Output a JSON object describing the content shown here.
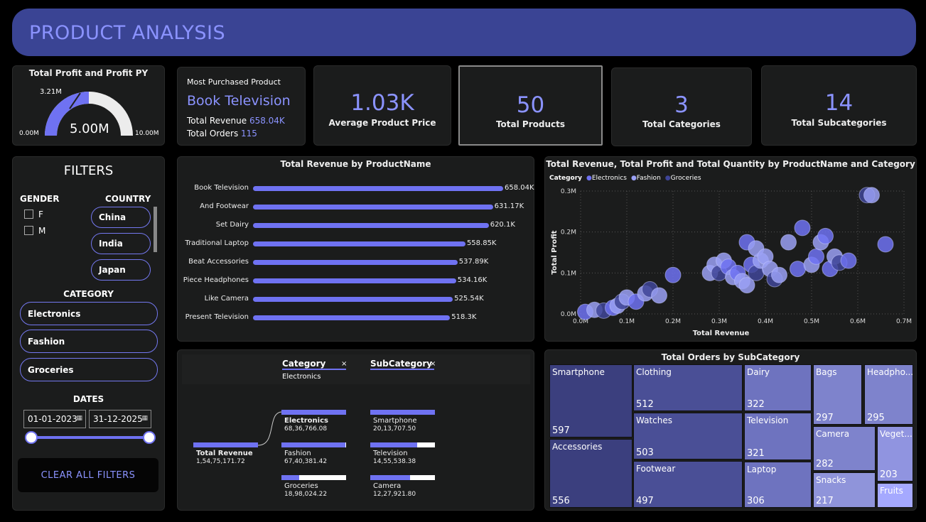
{
  "header": {
    "title": "PRODUCT ANALYSIS"
  },
  "gauge": {
    "title": "Total Profit and Profit PY",
    "value": "5.00M",
    "min": "0.00M",
    "max": "10.00M",
    "target": "3.21M",
    "fill_fraction": 0.5
  },
  "most_purchased": {
    "label": "Most Purchased Product",
    "product": "Book Television",
    "revenue_label": "Total Revenue",
    "revenue": "658.04K",
    "orders_label": "Total Orders",
    "orders": "115"
  },
  "kpis": [
    {
      "value": "1.03K",
      "label": "Average Product Price"
    },
    {
      "value": "50",
      "label": "Total Products"
    },
    {
      "value": "3",
      "label": "Total Categories"
    },
    {
      "value": "14",
      "label": "Total Subcategories"
    }
  ],
  "filters": {
    "title": "FILTERS",
    "gender_label": "GENDER",
    "genders": [
      "F",
      "M"
    ],
    "country_label": "COUNTRY",
    "countries": [
      "China",
      "India",
      "Japan"
    ],
    "category_label": "CATEGORY",
    "categories": [
      "Electronics",
      "Fashion",
      "Groceries"
    ],
    "dates_label": "DATES",
    "date_from": "01-01-2023",
    "date_to": "31-12-2025",
    "clear_label": "CLEAR ALL FILTERS",
    "calendar_icon": "▦"
  },
  "revenue_by_product": {
    "chart_data": {
      "type": "bar",
      "title": "Total Revenue by ProductName",
      "categories": [
        "Book Television",
        "And Footwear",
        "Set Dairy",
        "Traditional Laptop",
        "Beat Accessories",
        "Piece Headphones",
        "Like Camera",
        "Present Television"
      ],
      "values": [
        658.04,
        631.17,
        620.1,
        558.85,
        537.89,
        534.16,
        525.54,
        518.3
      ],
      "value_labels": [
        "658.04K",
        "631.17K",
        "620.1K",
        "558.85K",
        "537.89K",
        "534.16K",
        "525.54K",
        "518.3K"
      ],
      "unit": "K",
      "xlim": [
        0,
        658.04
      ]
    }
  },
  "scatter": {
    "chart_data": {
      "type": "scatter",
      "title": "Total Revenue, Total Profit and Total Quantity by ProductName and Category",
      "legend_title": "Category",
      "legend": [
        {
          "name": "Electronics",
          "color": "#6f72f2"
        },
        {
          "name": "Fashion",
          "color": "#9aa0f5"
        },
        {
          "name": "Groceries",
          "color": "#3f4598"
        }
      ],
      "xlabel": "Total Revenue",
      "ylabel": "Total Profit",
      "x_ticks": [
        "0.0M",
        "0.1M",
        "0.2M",
        "0.3M",
        "0.4M",
        "0.5M",
        "0.6M",
        "0.7M"
      ],
      "y_ticks": [
        "0.0M",
        "0.1M",
        "0.2M",
        "0.3M"
      ],
      "xlim": [
        0,
        0.7
      ],
      "ylim": [
        0,
        0.3
      ],
      "grid": true,
      "points": [
        [
          0.01,
          0.005,
          0
        ],
        [
          0.03,
          0.01,
          1
        ],
        [
          0.05,
          0.008,
          2
        ],
        [
          0.07,
          0.015,
          0
        ],
        [
          0.08,
          0.02,
          1
        ],
        [
          0.09,
          0.03,
          2
        ],
        [
          0.1,
          0.04,
          1
        ],
        [
          0.12,
          0.03,
          0
        ],
        [
          0.14,
          0.05,
          1
        ],
        [
          0.15,
          0.06,
          2
        ],
        [
          0.17,
          0.045,
          1
        ],
        [
          0.2,
          0.095,
          0
        ],
        [
          0.28,
          0.1,
          1
        ],
        [
          0.29,
          0.12,
          1
        ],
        [
          0.3,
          0.1,
          2
        ],
        [
          0.31,
          0.13,
          1
        ],
        [
          0.32,
          0.115,
          0
        ],
        [
          0.33,
          0.09,
          1
        ],
        [
          0.34,
          0.1,
          0
        ],
        [
          0.35,
          0.08,
          1
        ],
        [
          0.36,
          0.07,
          1
        ],
        [
          0.37,
          0.12,
          0
        ],
        [
          0.38,
          0.1,
          2
        ],
        [
          0.39,
          0.13,
          1
        ],
        [
          0.36,
          0.175,
          0
        ],
        [
          0.38,
          0.16,
          1
        ],
        [
          0.4,
          0.14,
          1
        ],
        [
          0.41,
          0.11,
          1
        ],
        [
          0.42,
          0.085,
          2
        ],
        [
          0.43,
          0.095,
          1
        ],
        [
          0.45,
          0.175,
          1
        ],
        [
          0.47,
          0.11,
          0
        ],
        [
          0.48,
          0.21,
          0
        ],
        [
          0.5,
          0.12,
          1
        ],
        [
          0.51,
          0.14,
          0
        ],
        [
          0.52,
          0.175,
          1
        ],
        [
          0.53,
          0.19,
          0
        ],
        [
          0.54,
          0.11,
          0
        ],
        [
          0.55,
          0.14,
          1
        ],
        [
          0.56,
          0.125,
          2
        ],
        [
          0.58,
          0.13,
          0
        ],
        [
          0.62,
          0.29,
          2
        ],
        [
          0.63,
          0.29,
          1
        ],
        [
          0.66,
          0.17,
          0
        ]
      ]
    }
  },
  "decomp": {
    "level1_title": "Category",
    "level1_filter": "Electronics",
    "level2_title": "SubCategory",
    "close_icon": "×",
    "root": {
      "label": "Total Revenue",
      "value": "1,54,75,171.72"
    },
    "categories": [
      {
        "label": "Electronics",
        "value": "68,36,766.08",
        "fraction": 1.0
      },
      {
        "label": "Fashion",
        "value": "67,40,381.42",
        "fraction": 0.99
      },
      {
        "label": "Groceries",
        "value": "18,98,024.22",
        "fraction": 0.28
      }
    ],
    "subcategories": [
      {
        "label": "Smartphone",
        "value": "20,13,707.50",
        "fraction": 1.0
      },
      {
        "label": "Television",
        "value": "14,55,538.38",
        "fraction": 0.72
      },
      {
        "label": "Camera",
        "value": "12,27,921.80",
        "fraction": 0.61
      }
    ]
  },
  "treemap": {
    "title": "Total Orders by SubCategory",
    "cells": [
      {
        "name": "Smartphone",
        "value": "597",
        "color": "#3b3f7e"
      },
      {
        "name": "Accessories",
        "value": "556",
        "color": "#3b3f7e"
      },
      {
        "name": "Clothing",
        "value": "512",
        "color": "#4a4f96"
      },
      {
        "name": "Watches",
        "value": "503",
        "color": "#4a4f96"
      },
      {
        "name": "Footwear",
        "value": "497",
        "color": "#4a4f96"
      },
      {
        "name": "Dairy",
        "value": "322",
        "color": "#6e73bf"
      },
      {
        "name": "Television",
        "value": "321",
        "color": "#6e73bf"
      },
      {
        "name": "Laptop",
        "value": "306",
        "color": "#6e73bf"
      },
      {
        "name": "Bags",
        "value": "297",
        "color": "#7e83cc"
      },
      {
        "name": "Headpho...",
        "value": "295",
        "color": "#7e83cc"
      },
      {
        "name": "Camera",
        "value": "282",
        "color": "#7e83cc"
      },
      {
        "name": "Snacks",
        "value": "217",
        "color": "#8f94da"
      },
      {
        "name": "Veget...",
        "value": "203",
        "color": "#9094e0"
      },
      {
        "name": "Fruits",
        "value": "",
        "color": "#a5a9ff"
      }
    ]
  }
}
